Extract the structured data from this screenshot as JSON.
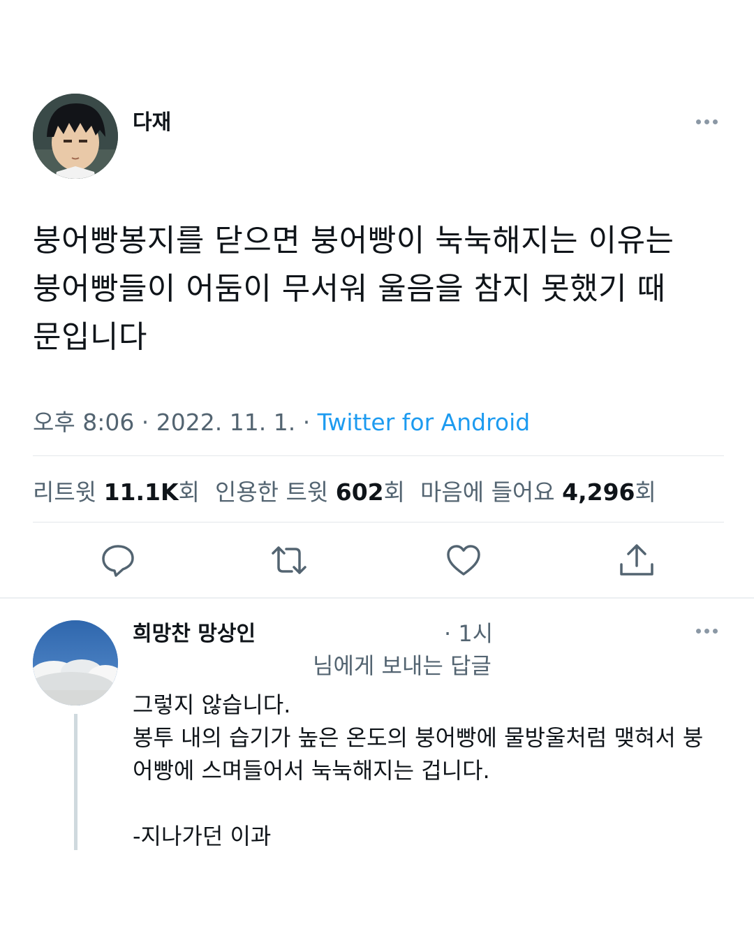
{
  "tweet": {
    "author": {
      "name": "다재",
      "avatar": "anime-boy-avatar"
    },
    "text": "붕어빵봉지를 닫으면 붕어빵이 눅눅해지는 이유는\n붕어빵들이 어둠이 무서워 울음을 참지 못했기 때\n문입니다",
    "timestamp": "오후 8:06 · 2022. 11. 1. · ",
    "source": "Twitter for Android",
    "stats": {
      "retweets_label": "리트윗 ",
      "retweets_value": "11.1K",
      "retweets_unit": "회",
      "quotes_label": "인용한 트윗 ",
      "quotes_value": "602",
      "quotes_unit": "회",
      "likes_label": "마음에 들어요 ",
      "likes_value": "4,296",
      "likes_unit": "회"
    },
    "actions": [
      "reply-icon",
      "retweet-icon",
      "like-icon",
      "share-icon"
    ]
  },
  "reply": {
    "author": {
      "name": "희망찬 망상인",
      "avatar": "sky-cloud-avatar"
    },
    "time": "· 1시",
    "replying_to": "님에게 보내는 답글",
    "text": "그렇지 않습니다.\n봉투 내의 습기가 높은 온도의 붕어빵에 물방울처럼 맺혀서 붕\n어빵에 스며들어서 눅눅해지는 겁니다.\n\n-지나가던 이과"
  },
  "colors": {
    "accent": "#1d9bf0",
    "secondary_text": "#536471",
    "primary_text": "#0f1419"
  }
}
